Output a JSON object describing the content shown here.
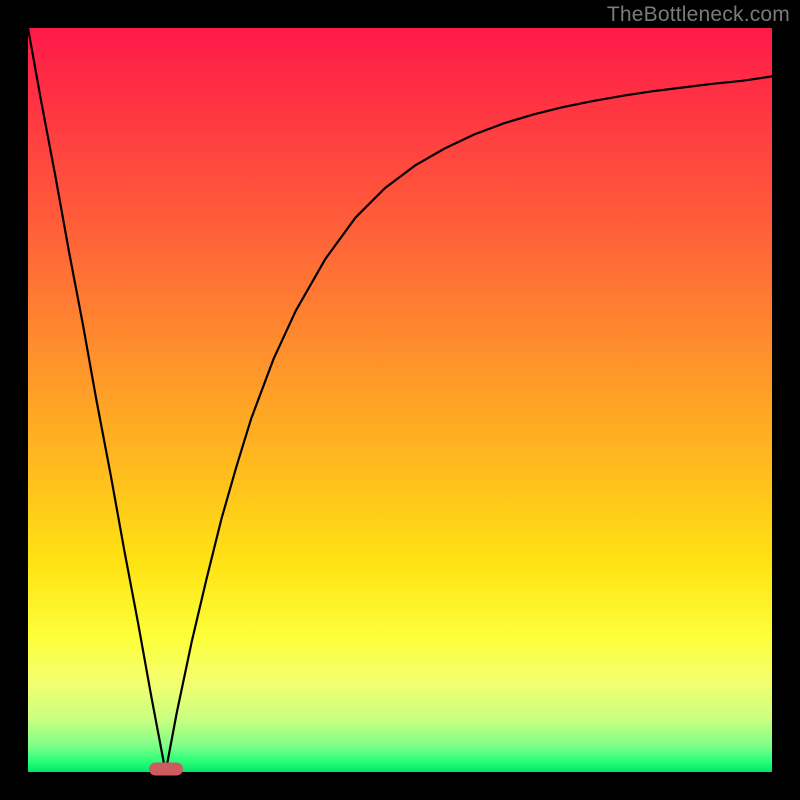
{
  "watermark": "TheBottleneck.com",
  "marker": {
    "x_frac": 0.185,
    "y_frac": 0.996
  },
  "chart_data": {
    "type": "line",
    "title": "",
    "xlabel": "",
    "ylabel": "",
    "xlim": [
      0,
      1
    ],
    "ylim": [
      0,
      1
    ],
    "grid": false,
    "series": [
      {
        "name": "left-line",
        "x": [
          0.0,
          0.018,
          0.037,
          0.055,
          0.074,
          0.092,
          0.111,
          0.129,
          0.148,
          0.166,
          0.185
        ],
        "values": [
          1.0,
          0.9,
          0.8,
          0.7,
          0.6,
          0.5,
          0.4,
          0.3,
          0.2,
          0.1,
          0.0
        ]
      },
      {
        "name": "right-curve",
        "x": [
          0.185,
          0.2,
          0.22,
          0.24,
          0.26,
          0.28,
          0.3,
          0.33,
          0.36,
          0.4,
          0.44,
          0.48,
          0.52,
          0.56,
          0.6,
          0.64,
          0.68,
          0.72,
          0.76,
          0.8,
          0.84,
          0.88,
          0.92,
          0.96,
          1.0
        ],
        "values": [
          0.0,
          0.08,
          0.175,
          0.26,
          0.34,
          0.41,
          0.475,
          0.555,
          0.62,
          0.69,
          0.745,
          0.785,
          0.815,
          0.838,
          0.857,
          0.872,
          0.884,
          0.894,
          0.902,
          0.909,
          0.915,
          0.92,
          0.925,
          0.929,
          0.935
        ]
      }
    ],
    "annotations": [
      {
        "name": "minimum-marker",
        "x": 0.185,
        "y": 0.0
      }
    ],
    "background_gradient": {
      "direction": "vertical",
      "stops": [
        {
          "pos": 0.0,
          "color": "#ff1a48"
        },
        {
          "pos": 0.25,
          "color": "#ff5a3a"
        },
        {
          "pos": 0.58,
          "color": "#ffb81f"
        },
        {
          "pos": 0.82,
          "color": "#fdff3a"
        },
        {
          "pos": 0.95,
          "color": "#7dff88"
        },
        {
          "pos": 1.0,
          "color": "#00e66a"
        }
      ]
    }
  }
}
